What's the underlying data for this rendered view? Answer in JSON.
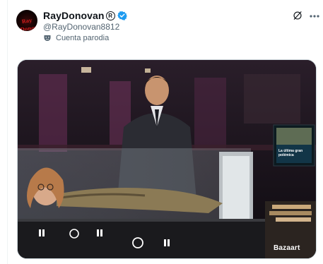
{
  "author": {
    "display_name": "RayDonovan",
    "handle": "@RayDonovan8812",
    "label": "Cuenta parodia",
    "avatar_text": "Ray Donovan"
  },
  "icons": {
    "verified": "verified-badge-icon",
    "registered": "registered-mark-icon",
    "parody": "theater-mask-icon",
    "grok": "grok-icon",
    "more": "more-dots-icon"
  },
  "media": {
    "tv_caption": "La última gran polémica",
    "watermark": "Bazaart"
  },
  "colors": {
    "verified_blue": "#1d9bf0",
    "secondary_text": "#536471",
    "primary_text": "#0f1419"
  }
}
